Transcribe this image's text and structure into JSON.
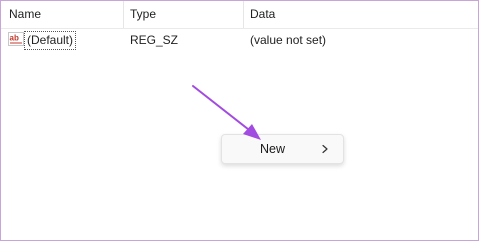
{
  "columns": {
    "name": "Name",
    "type": "Type",
    "data": "Data"
  },
  "rows": [
    {
      "icon": "string-value-icon",
      "name": "(Default)",
      "type": "REG_SZ",
      "data": "(value not set)"
    }
  ],
  "context_menu": {
    "items": [
      {
        "label": "New",
        "has_submenu": true
      }
    ]
  },
  "colors": {
    "frame_border": "#c9a4d8",
    "arrow": "#a24be0",
    "menu_bg": "#f9f9f9"
  }
}
